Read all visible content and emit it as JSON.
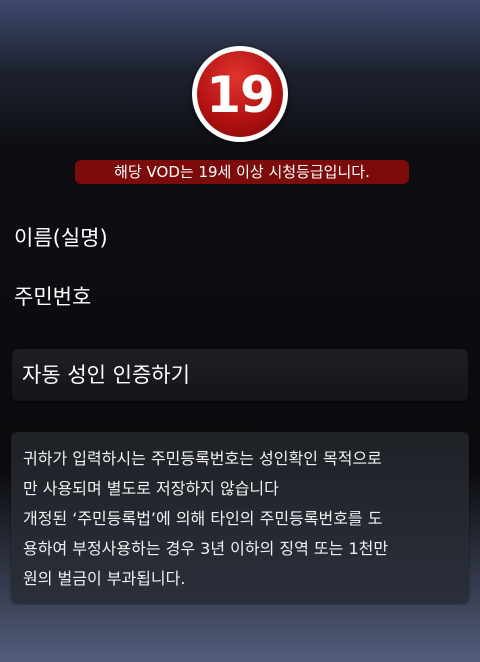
{
  "badge": {
    "text": "19"
  },
  "notice": {
    "text": "해당 VOD는 19세 이상 시청등급입니다."
  },
  "form": {
    "name_label": "이름(실명)",
    "id_label": "주민번호"
  },
  "auto_verify_button": {
    "label": "자동 성인 인증하기"
  },
  "info": {
    "lines": [
      "귀하가 입력하시는 주민등록번호는 성인확인 목적으로",
      "만 사용되며 별도로 저장하지 않습니다",
      "개정된 ‘주민등록법’에 의해 타인의 주민등록번호를 도",
      "용하여 부정사용하는 경우 3년 이하의 징역 또는 1천만",
      "원의 벌금이 부과됩니다."
    ]
  },
  "colors": {
    "badge_red": "#b41212",
    "notice_bg": "#7c0c0c"
  }
}
